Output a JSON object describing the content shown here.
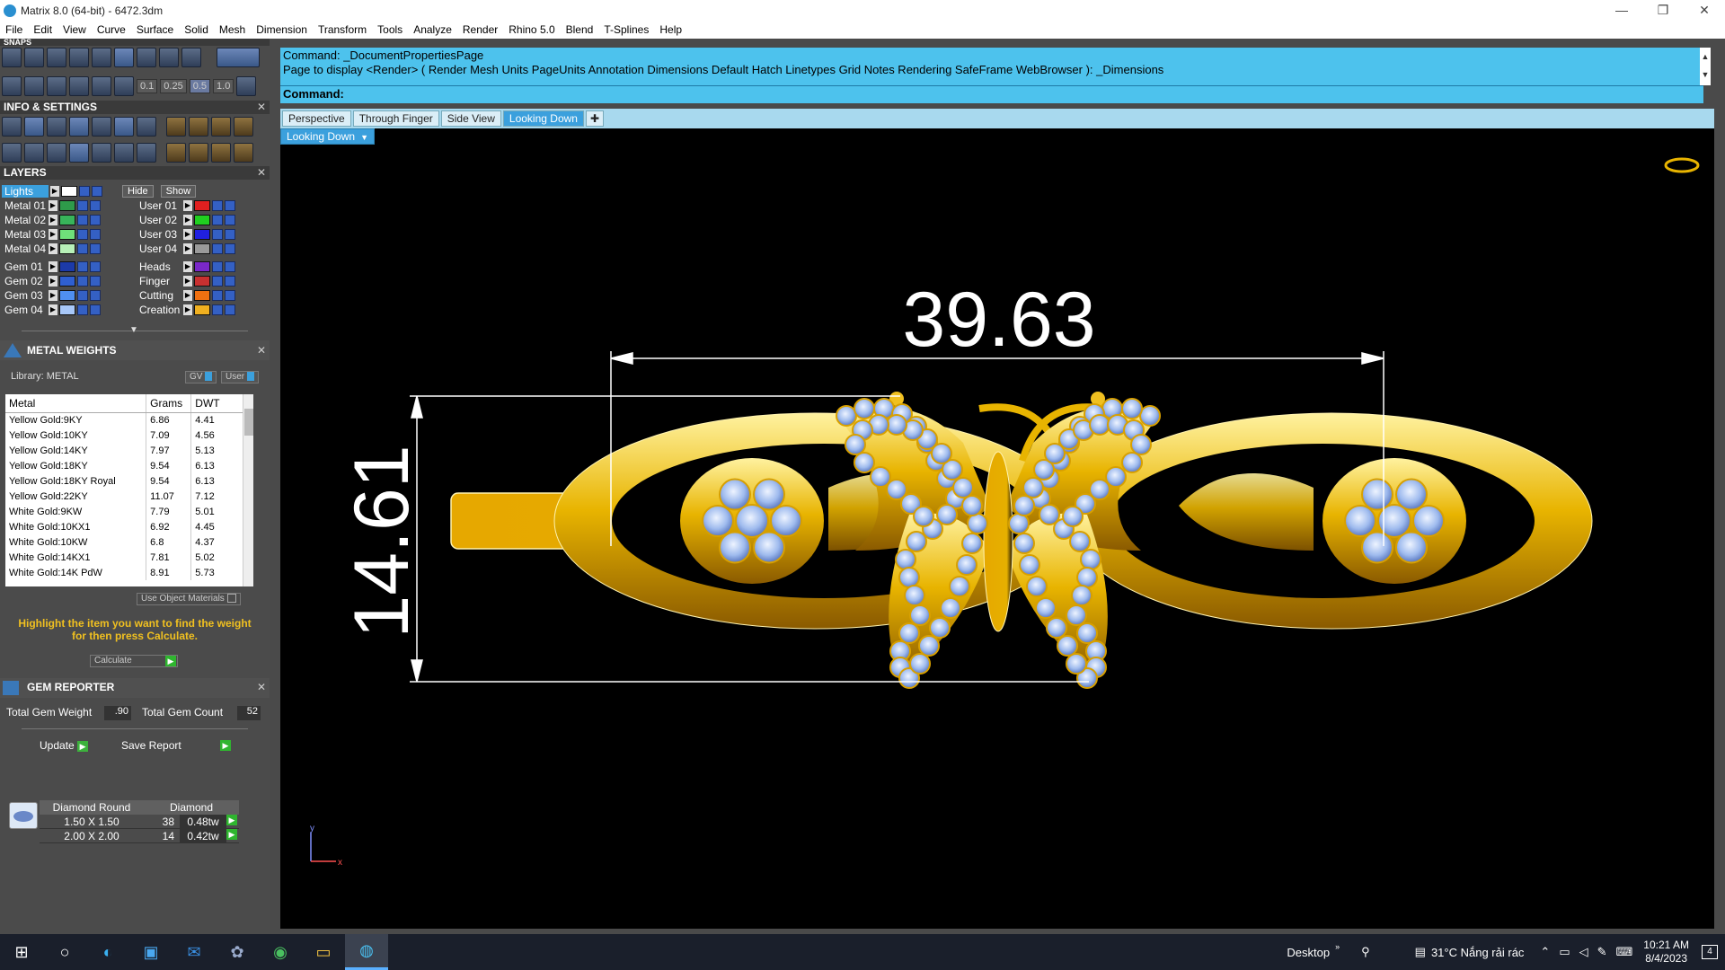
{
  "window": {
    "title": "Matrix 8.0 (64-bit) - 6472.3dm",
    "min": "—",
    "restore": "❐",
    "close": "✕"
  },
  "menu": [
    "File",
    "Edit",
    "View",
    "Curve",
    "Surface",
    "Solid",
    "Mesh",
    "Dimension",
    "Transform",
    "Tools",
    "Analyze",
    "Render",
    "Rhino 5.0",
    "Blend",
    "T-Splines",
    "Help"
  ],
  "snaps": {
    "title": "SNAPS",
    "values": [
      "0.1",
      "0.25",
      "0.5",
      "1.0"
    ]
  },
  "info": {
    "title": "INFO & SETTINGS"
  },
  "layers": {
    "title": "LAYERS",
    "lights": "Lights",
    "hide": "Hide",
    "show": "Show",
    "left": [
      {
        "name": "Metal 01",
        "color": "#2e9a4a"
      },
      {
        "name": "Metal 02",
        "color": "#38b45a"
      },
      {
        "name": "Metal 03",
        "color": "#6fe07a"
      },
      {
        "name": "Metal 04",
        "color": "#b8f0b8"
      },
      {
        "name": "Gem 01",
        "color": "#1c3aa8"
      },
      {
        "name": "Gem 02",
        "color": "#2f5fd0"
      },
      {
        "name": "Gem 03",
        "color": "#4f8ff0"
      },
      {
        "name": "Gem 04",
        "color": "#a8c8f8"
      }
    ],
    "right": [
      {
        "name": "User 01",
        "color": "#e02020"
      },
      {
        "name": "User 02",
        "color": "#20d020"
      },
      {
        "name": "User 03",
        "color": "#2020e0"
      },
      {
        "name": "User 04",
        "color": "#9a9a9a"
      },
      {
        "name": "Heads",
        "color": "#7a28c8"
      },
      {
        "name": "Finger",
        "color": "#c83030"
      },
      {
        "name": "Cutting",
        "color": "#f07010"
      },
      {
        "name": "Creation",
        "color": "#f0b020"
      }
    ]
  },
  "metal_weights": {
    "title": "METAL WEIGHTS",
    "library": "Library: METAL",
    "gv": "GV",
    "user": "User",
    "columns": [
      "Metal",
      "Grams",
      "DWT"
    ],
    "rows": [
      [
        "Yellow Gold:9KY",
        "6.86",
        "4.41"
      ],
      [
        "Yellow Gold:10KY",
        "7.09",
        "4.56"
      ],
      [
        "Yellow Gold:14KY",
        "7.97",
        "5.13"
      ],
      [
        "Yellow Gold:18KY",
        "9.54",
        "6.13"
      ],
      [
        "Yellow Gold:18KY Royal",
        "9.54",
        "6.13"
      ],
      [
        "Yellow Gold:22KY",
        "11.07",
        "7.12"
      ],
      [
        "White Gold:9KW",
        "7.79",
        "5.01"
      ],
      [
        "White Gold:10KX1",
        "6.92",
        "4.45"
      ],
      [
        "White Gold:10KW",
        "6.8",
        "4.37"
      ],
      [
        "White Gold:14KX1",
        "7.81",
        "5.02"
      ],
      [
        "White Gold:14K PdW",
        "8.91",
        "5.73"
      ]
    ],
    "use_object_materials": "Use Object Materials",
    "hint": "Highlight the item you want to find the weight for then press Calculate.",
    "calculate": "Calculate"
  },
  "gem_reporter": {
    "title": "GEM REPORTER",
    "total_weight_label": "Total Gem Weight",
    "total_weight": ".90",
    "total_count_label": "Total Gem Count",
    "total_count": "52",
    "update": "Update",
    "save_report": "Save Report",
    "columns": [
      "Diamond Round",
      "Diamond"
    ],
    "rows": [
      {
        "size": "1.50 X 1.50",
        "count": "38",
        "weight": "0.48tw"
      },
      {
        "size": "2.00 X 2.00",
        "count": "14",
        "weight": "0.42tw"
      }
    ]
  },
  "command": {
    "line1": "Command: _DocumentPropertiesPage",
    "line2": "Page to display <Render> ( Render  Mesh  Units  PageUnits  Annotation  Dimensions  Default  Hatch  Linetypes  Grid  Notes  Rendering  SafeFrame  WebBrowser ): _Dimensions",
    "prompt": "Command:"
  },
  "viewtabs": [
    "Perspective",
    "Through Finger",
    "Side View",
    "Looking Down"
  ],
  "active_tab": "Looking Down",
  "viewport": {
    "label": "Looking Down",
    "dim_width": "39.63",
    "dim_height": "14.61",
    "axis_y": "y",
    "axis_x": "x"
  },
  "taskbar": {
    "desktop": "Desktop",
    "weather": "31°C  Nắng rải rác",
    "time": "10:21 AM",
    "date": "8/4/2023",
    "notif": "4"
  }
}
